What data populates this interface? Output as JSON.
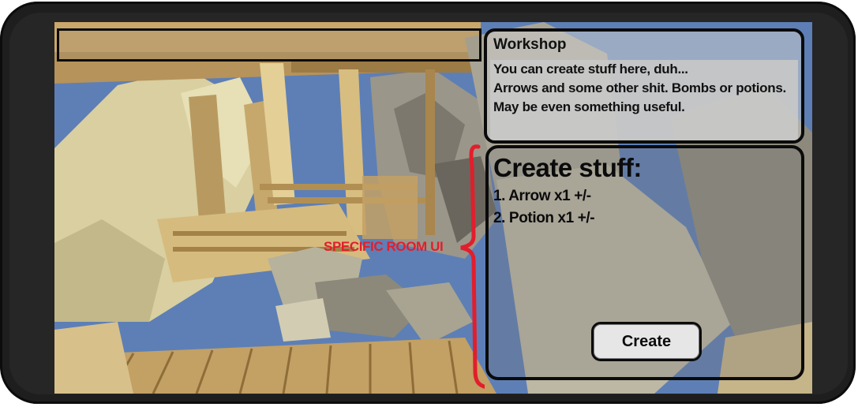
{
  "workshop_info": {
    "title": "Workshop",
    "description_lines": [
      "You can create stuff here, duh...",
      "Arrows and some other shit. Bombs or potions.",
      "May be even something useful."
    ]
  },
  "create_panel": {
    "title": "Create stuff:",
    "items": [
      {
        "label": "1. Arrow x1 +/-"
      },
      {
        "label": "2. Potion x1 +/-"
      }
    ],
    "create_button_label": "Create"
  },
  "annotation": {
    "label": "SPECIFIC ROOM UI",
    "color": "#e21e2c"
  },
  "colors": {
    "sky": "#5d7fb6",
    "panel_border": "#0b0b0b",
    "wood": "#c9a76a"
  }
}
